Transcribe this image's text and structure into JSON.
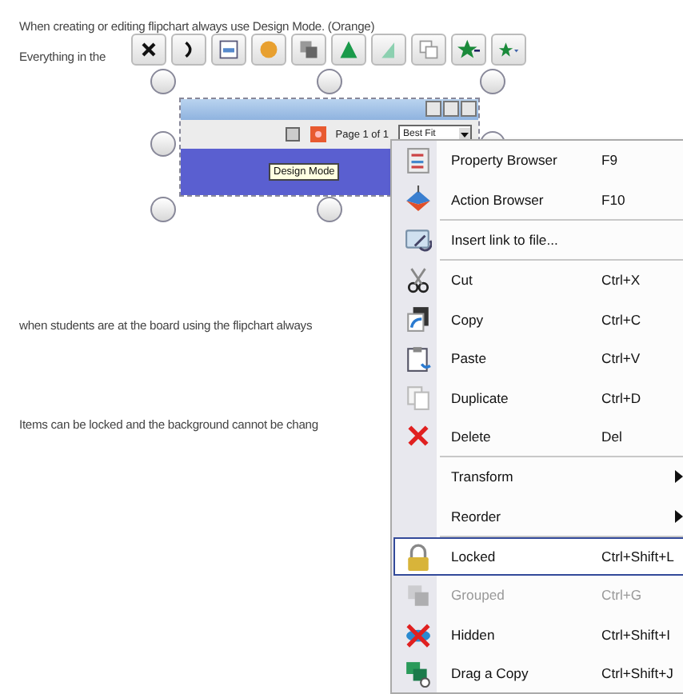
{
  "document": {
    "texts": [
      {
        "text": "When creating or editing flipchart always use Design Mode. (Orange)"
      },
      {
        "text": "Everything in the"
      },
      {
        "text": "when students are at the board using the flipchart always"
      },
      {
        "text": "Items can be locked and the background cannot be chang"
      }
    ]
  },
  "embedded_window": {
    "page_label": "Page 1 of 1",
    "zoom_value": "Best Fit",
    "tooltip": "Design Mode"
  },
  "context_menu": {
    "items": [
      {
        "kind": "item",
        "label": "Property Browser",
        "shortcut": "F9",
        "submenu": false,
        "selected": false,
        "disabled": false
      },
      {
        "kind": "item",
        "label": "Action Browser",
        "shortcut": "F10",
        "submenu": false,
        "selected": false,
        "disabled": false
      },
      {
        "kind": "separator"
      },
      {
        "kind": "item",
        "label": "Insert link to file...",
        "submenu": false,
        "selected": false,
        "disabled": false
      },
      {
        "kind": "separator"
      },
      {
        "kind": "item",
        "label": "Cut",
        "shortcut": "Ctrl+X",
        "submenu": false,
        "selected": false,
        "disabled": false
      },
      {
        "kind": "item",
        "label": "Copy",
        "shortcut": "Ctrl+C",
        "submenu": false,
        "selected": false,
        "disabled": false
      },
      {
        "kind": "item",
        "label": "Paste",
        "shortcut": "Ctrl+V",
        "submenu": false,
        "selected": false,
        "disabled": false
      },
      {
        "kind": "item",
        "label": "Duplicate",
        "shortcut": "Ctrl+D",
        "submenu": false,
        "selected": false,
        "disabled": false
      },
      {
        "kind": "item",
        "label": "Delete",
        "shortcut": "Del",
        "submenu": false,
        "selected": false,
        "disabled": false
      },
      {
        "kind": "separator"
      },
      {
        "kind": "item",
        "label": "Transform",
        "submenu": true,
        "selected": false,
        "disabled": false
      },
      {
        "kind": "item",
        "label": "Reorder",
        "submenu": true,
        "selected": false,
        "disabled": false
      },
      {
        "kind": "separator"
      },
      {
        "kind": "item",
        "label": "Locked",
        "shortcut": "Ctrl+Shift+L",
        "submenu": false,
        "selected": true,
        "disabled": false
      },
      {
        "kind": "item",
        "label": "Grouped",
        "shortcut": "Ctrl+G",
        "submenu": false,
        "selected": false,
        "disabled": true
      },
      {
        "kind": "item",
        "label": "Hidden",
        "shortcut": "Ctrl+Shift+I",
        "submenu": false,
        "selected": false,
        "disabled": false
      },
      {
        "kind": "item",
        "label": "Drag a Copy",
        "shortcut": "Ctrl+Shift+J",
        "submenu": false,
        "selected": false,
        "disabled": false
      }
    ]
  }
}
